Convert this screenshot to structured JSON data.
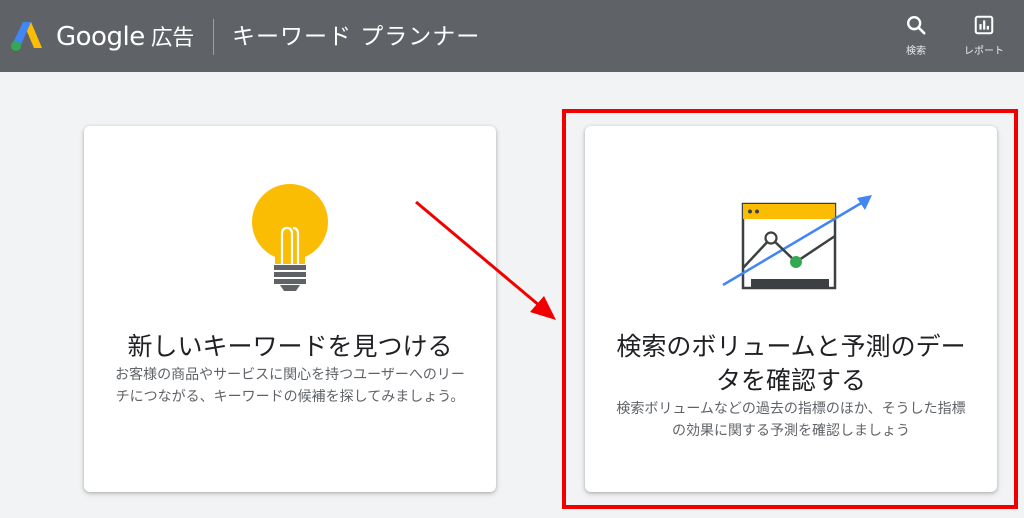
{
  "header": {
    "brand": "Google",
    "brand_sub": "広告",
    "app_title": "キーワード プランナー",
    "tools": [
      {
        "label": "検索",
        "icon": "search-icon"
      },
      {
        "label": "レポート",
        "icon": "report-icon"
      }
    ]
  },
  "cards": [
    {
      "title": "新しいキーワードを見つける",
      "desc": "お客様の商品やサービスに関心を持つユーザーへのリーチにつながる、キーワードの候補を探してみましょう。",
      "icon": "lightbulb-icon"
    },
    {
      "title": "検索のボリュームと予測のデータを確認する",
      "desc": "検索ボリュームなどの過去の指標のほか、そうした指標の効果に関する予測を確認しましょう",
      "icon": "trend-chart-icon"
    }
  ],
  "colors": {
    "topbar": "#5f6368",
    "background": "#f1f3f4",
    "annotation": "#f20000",
    "bulb": "#fbbc04",
    "trend_blue": "#4285f4",
    "point_green": "#34a853"
  }
}
